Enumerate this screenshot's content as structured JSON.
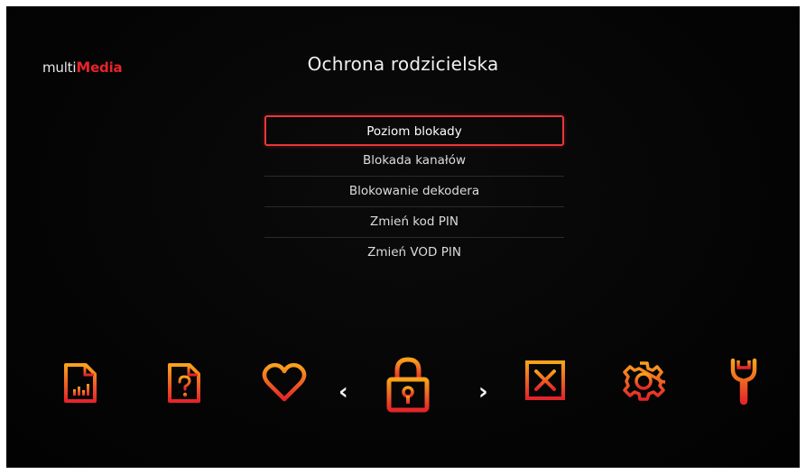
{
  "header": {
    "logo_prefix": "multi",
    "logo_accent_m": "M",
    "logo_accent_rest": "edia",
    "title": "Ochrona rodzicielska"
  },
  "menu": {
    "items": [
      {
        "label": "Poziom blokady",
        "selected": true
      },
      {
        "label": "Blokada kanałów",
        "selected": false
      },
      {
        "label": "Blokowanie dekodera",
        "selected": false
      },
      {
        "label": "Zmień kod PIN",
        "selected": false
      },
      {
        "label": "Zmień VOD PIN",
        "selected": false
      }
    ]
  },
  "dock": {
    "icons": [
      "document-chart-icon",
      "document-help-icon",
      "heart-icon",
      "lock-icon",
      "close-box-icon",
      "gear-icon",
      "wrench-icon"
    ],
    "left_arrow": "‹",
    "right_arrow": "›"
  },
  "colors": {
    "accent_red": "#e8242b",
    "accent_orange": "#f7941d",
    "selection_border": "#e8373a"
  }
}
